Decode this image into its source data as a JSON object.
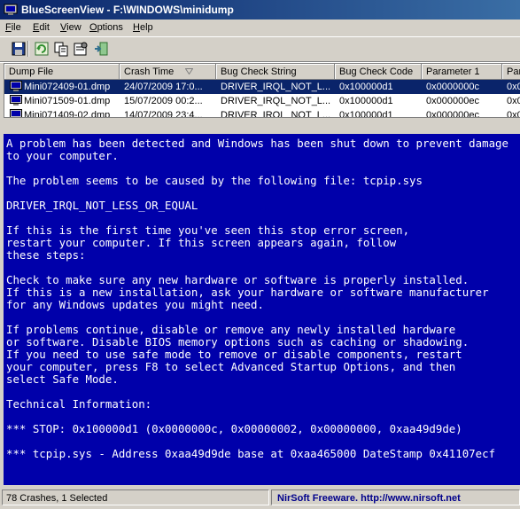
{
  "window": {
    "title": "BlueScreenView    -  F:\\WINDOWS\\minidump"
  },
  "menu": [
    {
      "label": "File",
      "accel": "F",
      "rest": "ile"
    },
    {
      "label": "Edit",
      "accel": "E",
      "rest": "dit"
    },
    {
      "label": "View",
      "accel": "V",
      "rest": "iew"
    },
    {
      "label": "Options",
      "accel": "O",
      "rest": "ptions"
    },
    {
      "label": "Help",
      "accel": "H",
      "rest": "elp"
    }
  ],
  "toolbar": [
    {
      "name": "save-icon"
    },
    {
      "name": "refresh-icon"
    },
    {
      "name": "copy-icon"
    },
    {
      "name": "properties-icon"
    },
    {
      "name": "exit-icon"
    }
  ],
  "table": {
    "columns": [
      "Dump File",
      "Crash Time",
      "Bug Check String",
      "Bug Check Code",
      "Parameter 1",
      "Par"
    ],
    "sort_indicator": "Crash Time",
    "rows": [
      {
        "file": "Mini072409-01.dmp",
        "time": "24/07/2009 17:0...",
        "string": "DRIVER_IRQL_NOT_L...",
        "code": "0x100000d1",
        "param1": "0x0000000c",
        "param2": "0x0",
        "selected": true
      },
      {
        "file": "Mini071509-01.dmp",
        "time": "15/07/2009 00:2...",
        "string": "DRIVER_IRQL_NOT_L...",
        "code": "0x100000d1",
        "param1": "0x000000ec",
        "param2": "0x0",
        "selected": false
      },
      {
        "file": "Mini071409-02.dmp",
        "time": "14/07/2009 23:4...",
        "string": "DRIVER_IRQL_NOT_L...",
        "code": "0x100000d1",
        "param1": "0x000000ec",
        "param2": "0x0",
        "selected": false
      }
    ]
  },
  "bsod": [
    "A problem has been detected and Windows has been shut down to prevent damage",
    "to your computer.",
    "",
    "The problem seems to be caused by the following file: tcpip.sys",
    "",
    "DRIVER_IRQL_NOT_LESS_OR_EQUAL",
    "",
    "If this is the first time you've seen this stop error screen,",
    "restart your computer. If this screen appears again, follow",
    "these steps:",
    "",
    "Check to make sure any new hardware or software is properly installed.",
    "If this is a new installation, ask your hardware or software manufacturer",
    "for any Windows updates you might need.",
    "",
    "If problems continue, disable or remove any newly installed hardware",
    "or software. Disable BIOS memory options such as caching or shadowing.",
    "If you need to use safe mode to remove or disable components, restart",
    "your computer, press F8 to select Advanced Startup Options, and then",
    "select Safe Mode.",
    "",
    "Technical Information:",
    "",
    "*** STOP: 0x100000d1 (0x0000000c, 0x00000002, 0x00000000, 0xaa49d9de)",
    "",
    "*** tcpip.sys - Address 0xaa49d9de base at 0xaa465000 DateStamp 0x41107ecf"
  ],
  "status": {
    "count": "78 Crashes, 1 Selected",
    "brand": "NirSoft Freeware.",
    "url": "http://www.nirsoft.net"
  }
}
